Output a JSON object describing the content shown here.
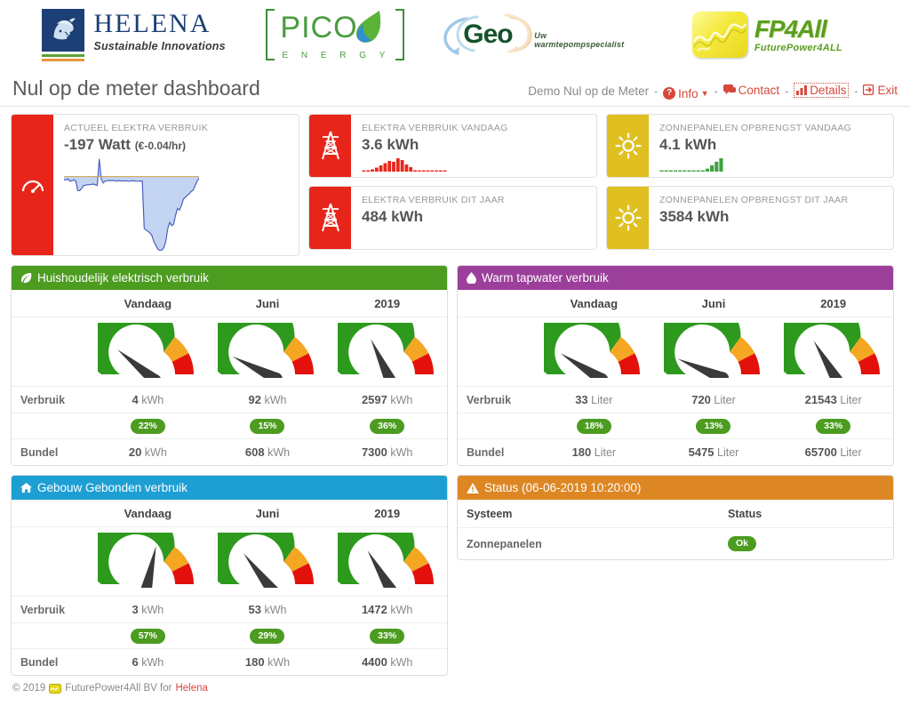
{
  "logos": {
    "helena": {
      "name": "HELENA",
      "tagline": "Sustainable Innovations",
      "icon": "greek-helmet-icon"
    },
    "pico": {
      "name": "PICO",
      "tagline": "E N E R G Y",
      "icon": "leaf-droplet-icon"
    },
    "geo": {
      "name": "Geo",
      "tagline": "Uw warmtepompspecialist",
      "icon": "circular-arrows-icon"
    },
    "fp4all": {
      "name": "FP4All",
      "tagline": "FuturePower4ALL",
      "icon": "waveform-badge-icon"
    }
  },
  "header": {
    "title": "Nul op de meter dashboard",
    "account": "Demo Nul op de Meter",
    "nav": [
      {
        "label": "Info",
        "icon": "question-circle-icon",
        "has_caret": true,
        "active": false
      },
      {
        "label": "Contact",
        "icon": "comment-icon",
        "has_caret": false,
        "active": false
      },
      {
        "label": "Details",
        "icon": "bar-chart-icon",
        "has_caret": false,
        "active": true
      },
      {
        "label": "Exit",
        "icon": "sign-out-icon",
        "has_caret": false,
        "active": false
      }
    ],
    "separator": "-"
  },
  "kpis": {
    "actual": {
      "label": "ACTUEEL ELEKTRA VERBRUIK",
      "value": "-197 Watt",
      "sub": "(€-0.04/hr)",
      "icon": "gauge-icon",
      "accent": "#e8251b"
    },
    "electra_today": {
      "label": "ELEKTRA VERBRUIK VANDAAG",
      "value": "3.6 kWh",
      "icon": "pylon-icon",
      "accent": "#e8251b"
    },
    "electra_year": {
      "label": "ELEKTRA VERBRUIK DIT JAAR",
      "value": "484 kWh",
      "icon": "pylon-icon",
      "accent": "#e8251b"
    },
    "solar_today": {
      "label": "ZONNEPANELEN OPBRENGST VANDAAG",
      "value": "4.1 kWh",
      "icon": "sun-icon",
      "accent": "#e0c020"
    },
    "solar_year": {
      "label": "ZONNEPANELEN OPBRENGST DIT JAAR",
      "value": "3584 kWh",
      "icon": "sun-icon",
      "accent": "#e0c020"
    }
  },
  "chart_data": [
    {
      "type": "area",
      "name": "actueel-elektra-verbruik-sparkline",
      "title": "ACTUEEL ELEKTRA VERBRUIK",
      "ylabel": "Watt",
      "color": "#4a5fc1",
      "fill": "#c3d4f2",
      "baseline": 0,
      "ylim": [
        -1000,
        260
      ],
      "values": [
        -40,
        -45,
        -30,
        -60,
        -55,
        -45,
        -55,
        -185,
        -190,
        -160,
        -120,
        -115,
        -110,
        -110,
        -105,
        -100,
        -110,
        -118,
        240,
        -30,
        -85,
        -60,
        -55,
        -50,
        -55,
        -50,
        -55,
        -60,
        -52,
        -58,
        -60,
        -55,
        -58,
        -62,
        -60,
        -55,
        -58,
        -60,
        -62,
        -58,
        -60,
        -700,
        -720,
        -740,
        -760,
        -800,
        -880,
        -930,
        -980,
        -995,
        -990,
        -960,
        -870,
        -700,
        -620,
        -660,
        -640,
        -520,
        -430,
        -450,
        -390,
        -300,
        -280,
        -250,
        -230,
        -200,
        -180,
        -120,
        -60,
        -20
      ]
    },
    {
      "type": "bar",
      "name": "elektra-verbruik-vandaag-sparkbar",
      "color": "#e8251b",
      "values": [
        2,
        3,
        5,
        9,
        14,
        19,
        24,
        22,
        30,
        26,
        16,
        10,
        3,
        2,
        2,
        2,
        2,
        2,
        2,
        2
      ]
    },
    {
      "type": "bar",
      "name": "zonnepanelen-opbrengst-vandaag-sparkbar",
      "color": "#3fa23f",
      "values": [
        2,
        2,
        2,
        2,
        2,
        2,
        2,
        2,
        2,
        2,
        6,
        13,
        20,
        27
      ]
    }
  ],
  "panels": {
    "household": {
      "title": "Huishoudelijk elektrisch verbruik",
      "icon": "leaf-icon",
      "accent": "#4c9c20",
      "columns": [
        "Vandaag",
        "Juni",
        "2019"
      ],
      "row_labels": {
        "usage": "Verbruik",
        "bundle": "Bundel"
      },
      "unit": "kWh",
      "cells": [
        {
          "usage": "4",
          "pct": "22%",
          "pct_value": 22,
          "bundle": "20"
        },
        {
          "usage": "92",
          "pct": "15%",
          "pct_value": 15,
          "bundle": "608"
        },
        {
          "usage": "2597",
          "pct": "36%",
          "pct_value": 36,
          "bundle": "7300"
        }
      ]
    },
    "water": {
      "title": "Warm tapwater verbruik",
      "icon": "droplet-icon",
      "accent": "#9b3f9b",
      "columns": [
        "Vandaag",
        "Juni",
        "2019"
      ],
      "row_labels": {
        "usage": "Verbruik",
        "bundle": "Bundel"
      },
      "unit": "Liter",
      "cells": [
        {
          "usage": "33",
          "pct": "18%",
          "pct_value": 18,
          "bundle": "180"
        },
        {
          "usage": "720",
          "pct": "13%",
          "pct_value": 13,
          "bundle": "5475"
        },
        {
          "usage": "21543",
          "pct": "33%",
          "pct_value": 33,
          "bundle": "65700"
        }
      ]
    },
    "building": {
      "title": "Gebouw Gebonden verbruik",
      "icon": "home-icon",
      "accent": "#1e9fd4",
      "columns": [
        "Vandaag",
        "Juni",
        "2019"
      ],
      "row_labels": {
        "usage": "Verbruik",
        "bundle": "Bundel"
      },
      "unit": "kWh",
      "cells": [
        {
          "usage": "3",
          "pct": "57%",
          "pct_value": 57,
          "bundle": "6"
        },
        {
          "usage": "53",
          "pct": "29%",
          "pct_value": 29,
          "bundle": "180"
        },
        {
          "usage": "1472",
          "pct": "33%",
          "pct_value": 33,
          "bundle": "4400"
        }
      ]
    },
    "status": {
      "title": "Status (06-06-2019 10:20:00)",
      "icon": "warning-triangle-icon",
      "accent": "#dd8724",
      "headers": {
        "system": "Systeem",
        "status": "Status"
      },
      "rows": [
        {
          "system": "Zonnepanelen",
          "status": "Ok"
        }
      ]
    }
  },
  "gauge": {
    "green_end_pct": 70,
    "orange_end_pct": 85,
    "colors": {
      "green": "#2d9a1e",
      "orange": "#f5a623",
      "red": "#e3110b",
      "needle": "#3a3a3a"
    }
  },
  "footer": {
    "copyright": "© 2019",
    "company": "FuturePower4All BV for",
    "brand": "Helena",
    "icon": "fp4all-mini-icon"
  }
}
